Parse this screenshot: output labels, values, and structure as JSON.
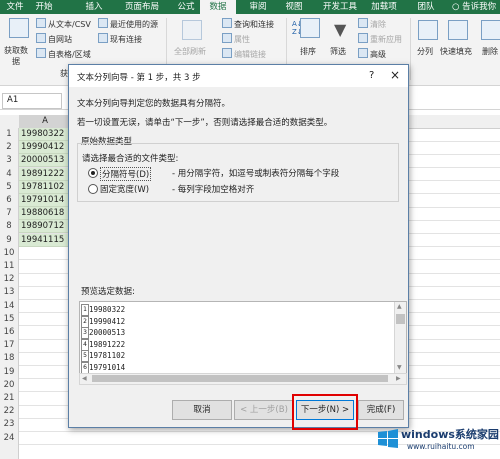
{
  "ribbon_tabs": [
    {
      "label": "文件",
      "active": false
    },
    {
      "label": "开始",
      "active": false
    },
    {
      "label": "插入",
      "active": false
    },
    {
      "label": "页面布局",
      "active": false
    },
    {
      "label": "公式",
      "active": false
    },
    {
      "label": "数据",
      "active": true
    },
    {
      "label": "审阅",
      "active": false
    },
    {
      "label": "视图",
      "active": false
    },
    {
      "label": "开发工具",
      "active": false
    },
    {
      "label": "加载项",
      "active": false
    },
    {
      "label": "团队",
      "active": false
    },
    {
      "label": "告诉我你",
      "active": false
    }
  ],
  "ribbon": {
    "get_data_l1": "获取数",
    "get_data_l2": "据",
    "from_text": "从文本/CSV",
    "from_web": "自网站",
    "from_table": "自表格/区域",
    "recent_sources": "最近使用的源",
    "existing_conn": "现有连接",
    "group_get": "获取",
    "refresh_all": "全部刷新",
    "queries_conn": "查询和连接",
    "properties": "属性",
    "edit_links": "编辑链接",
    "sort": "排序",
    "filter": "筛选",
    "clear": "清除",
    "reapply": "重新应用",
    "advanced": "高级",
    "text_to_columns": "分列",
    "flash_fill": "快速填充",
    "remove_dup": "删除"
  },
  "formula_bar": {
    "cell_ref": "A1"
  },
  "sheet": {
    "column_a": "A",
    "rows": [
      "1",
      "2",
      "3",
      "4",
      "5",
      "6",
      "7",
      "8",
      "9",
      "10",
      "11",
      "12",
      "13",
      "14",
      "15",
      "16",
      "17",
      "18",
      "19",
      "20",
      "21",
      "22",
      "23",
      "24"
    ],
    "cells": [
      "19980322",
      "19990412",
      "20000513",
      "19891222",
      "19781102",
      "19791014",
      "19880618",
      "19890712",
      "19941115"
    ]
  },
  "dialog": {
    "title": "文本分列向导 - 第 1 步，共 3 步",
    "help": "?",
    "close": "×",
    "intro1": "文本分列向导判定您的数据具有分隔符。",
    "intro2": "若一切设置无误，请单击“下一步”，否则请选择最合适的数据类型。",
    "group_title": "原始数据类型",
    "choose_type": "请选择最合适的文件类型:",
    "opt_delimited": "分隔符号(D)",
    "opt_delimited_desc": "- 用分隔字符，如逗号或制表符分隔每个字段",
    "opt_fixed": "固定宽度(W)",
    "opt_fixed_desc": "- 每列字段加空格对齐",
    "preview_label": "预览选定数据:",
    "preview_rows": [
      {
        "n": "1",
        "t": "19980322"
      },
      {
        "n": "2",
        "t": "19990412"
      },
      {
        "n": "3",
        "t": "20000513"
      },
      {
        "n": "4",
        "t": "19891222"
      },
      {
        "n": "5",
        "t": "19781102"
      },
      {
        "n": "6",
        "t": "19791014"
      }
    ],
    "btn_cancel": "取消",
    "btn_back": "< 上一步(B)",
    "btn_next": "下一步(N) >",
    "btn_finish": "完成(F)"
  },
  "watermark": {
    "brand": "windows系统家园",
    "url": "www.ruihaitu.com"
  },
  "colors": {
    "excel_green": "#217346",
    "highlight_red": "#e00000",
    "cell_fill": "#d9ead3"
  }
}
